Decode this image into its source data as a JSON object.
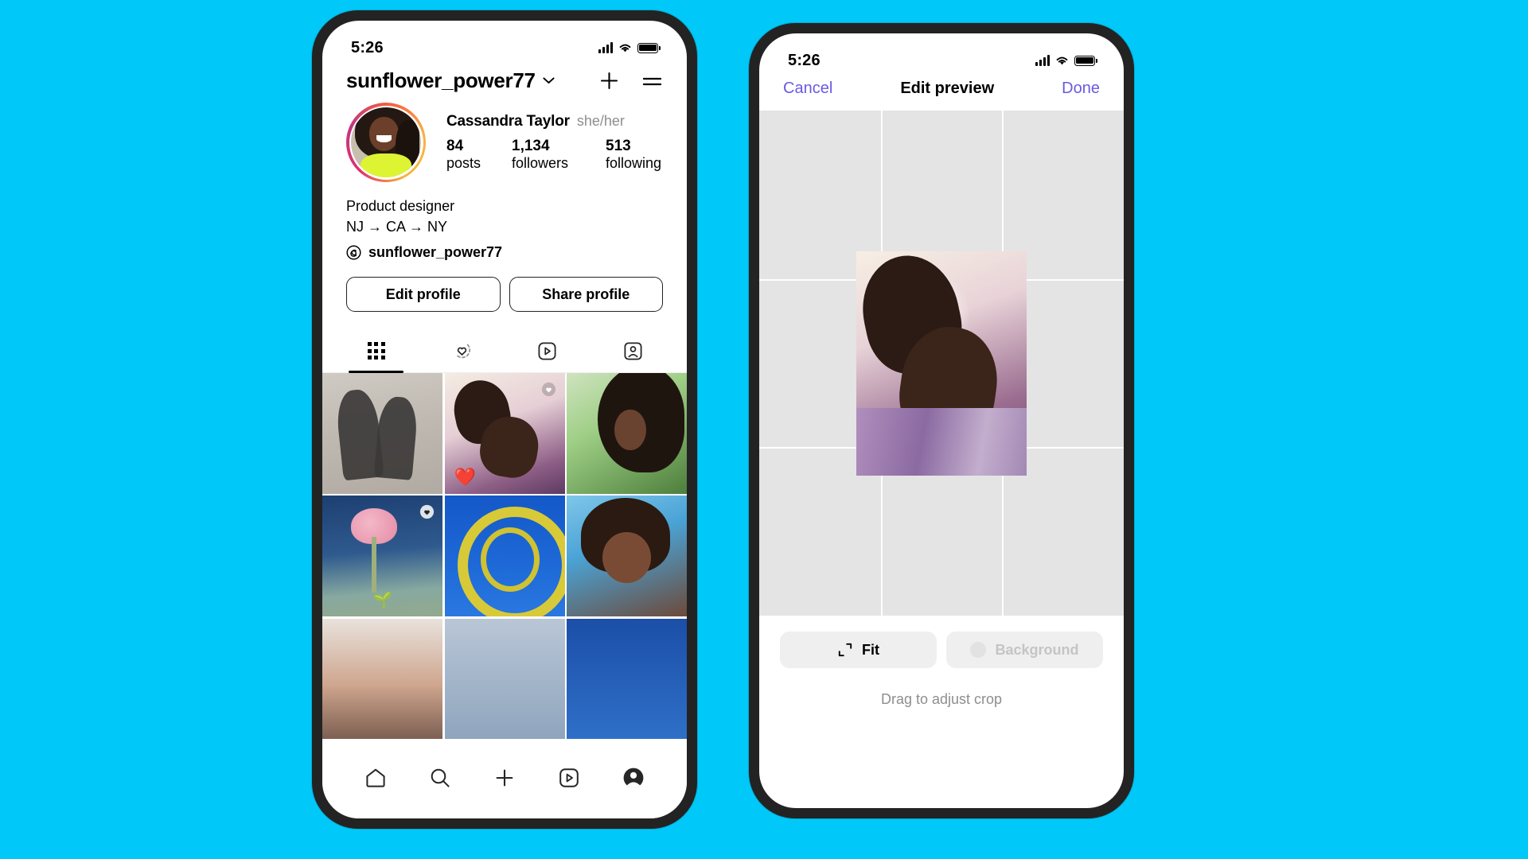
{
  "canvas": {
    "background_color": "#00c8f8"
  },
  "left_phone": {
    "status": {
      "time": "5:26",
      "signal_icon": "cellular-signal-icon",
      "wifi_icon": "wifi-icon",
      "battery_icon": "battery-full-icon"
    },
    "topbar": {
      "username": "sunflower_power77",
      "chevron_icon": "chevron-down-icon",
      "add_icon": "plus-icon",
      "menu_icon": "hamburger-menu-icon"
    },
    "profile": {
      "avatar_name": "profile-avatar",
      "full_name": "Cassandra Taylor",
      "pronouns": "she/her",
      "stats": [
        {
          "number": "84",
          "label": "posts"
        },
        {
          "number": "1,134",
          "label": "followers"
        },
        {
          "number": "513",
          "label": "following"
        }
      ],
      "bio_lines": [
        "Product designer",
        "NJ → CA → NY"
      ],
      "threads_icon": "threads-icon",
      "threads_handle": "sunflower_power77",
      "buttons": [
        {
          "label": "Edit profile"
        },
        {
          "label": "Share profile"
        }
      ]
    },
    "tabs": [
      {
        "name": "grid",
        "icon": "grid-icon",
        "active": true
      },
      {
        "name": "collabs",
        "icon": "heart-sparkle-icon",
        "active": false
      },
      {
        "name": "reels",
        "icon": "reels-play-icon",
        "active": false
      },
      {
        "name": "tagged",
        "icon": "tagged-person-icon",
        "active": false
      }
    ],
    "posts": [
      {
        "name": "post-shadow-couple",
        "style": "ph-shadow",
        "badge": "",
        "overlay": ""
      },
      {
        "name": "post-two-friends",
        "style": "ph-couple",
        "badge": "collab-icon",
        "overlay": "heart"
      },
      {
        "name": "post-earring-portrait",
        "style": "ph-earring",
        "badge": "",
        "overlay": ""
      },
      {
        "name": "post-pink-flower",
        "style": "ph-flower",
        "badge": "collab-icon",
        "overlay": "pin"
      },
      {
        "name": "post-ferris-wheel",
        "style": "ph-wheel",
        "badge": "",
        "overlay": ""
      },
      {
        "name": "post-laughing-portrait",
        "style": "ph-laugh",
        "badge": "",
        "overlay": ""
      },
      {
        "name": "post-partial-a",
        "style": "ph-strip-a",
        "badge": "",
        "overlay": ""
      },
      {
        "name": "post-partial-b",
        "style": "ph-strip-b",
        "badge": "",
        "overlay": ""
      },
      {
        "name": "post-partial-c",
        "style": "ph-strip-c",
        "badge": "",
        "overlay": ""
      }
    ],
    "bottom_nav": [
      {
        "name": "nav-home",
        "icon": "home-icon"
      },
      {
        "name": "nav-search",
        "icon": "search-icon"
      },
      {
        "name": "nav-create",
        "icon": "plus-icon"
      },
      {
        "name": "nav-reels",
        "icon": "reels-play-icon"
      },
      {
        "name": "nav-profile",
        "icon": "profile-avatar-icon"
      }
    ]
  },
  "right_phone": {
    "status": {
      "time": "5:26",
      "signal_icon": "cellular-signal-icon",
      "wifi_icon": "wifi-icon",
      "battery_icon": "battery-full-icon"
    },
    "topbar": {
      "cancel_label": "Cancel",
      "title": "Edit preview",
      "done_label": "Done",
      "link_color": "#6a5ae0"
    },
    "crop": {
      "photo_name": "crop-preview-photo",
      "grid_overlay": "rule-of-thirds-grid"
    },
    "tools": [
      {
        "label": "Fit",
        "icon": "fit-crop-icon",
        "disabled": false
      },
      {
        "label": "Background",
        "icon": "background-color-icon",
        "disabled": true
      }
    ],
    "hint": "Drag to adjust crop"
  }
}
